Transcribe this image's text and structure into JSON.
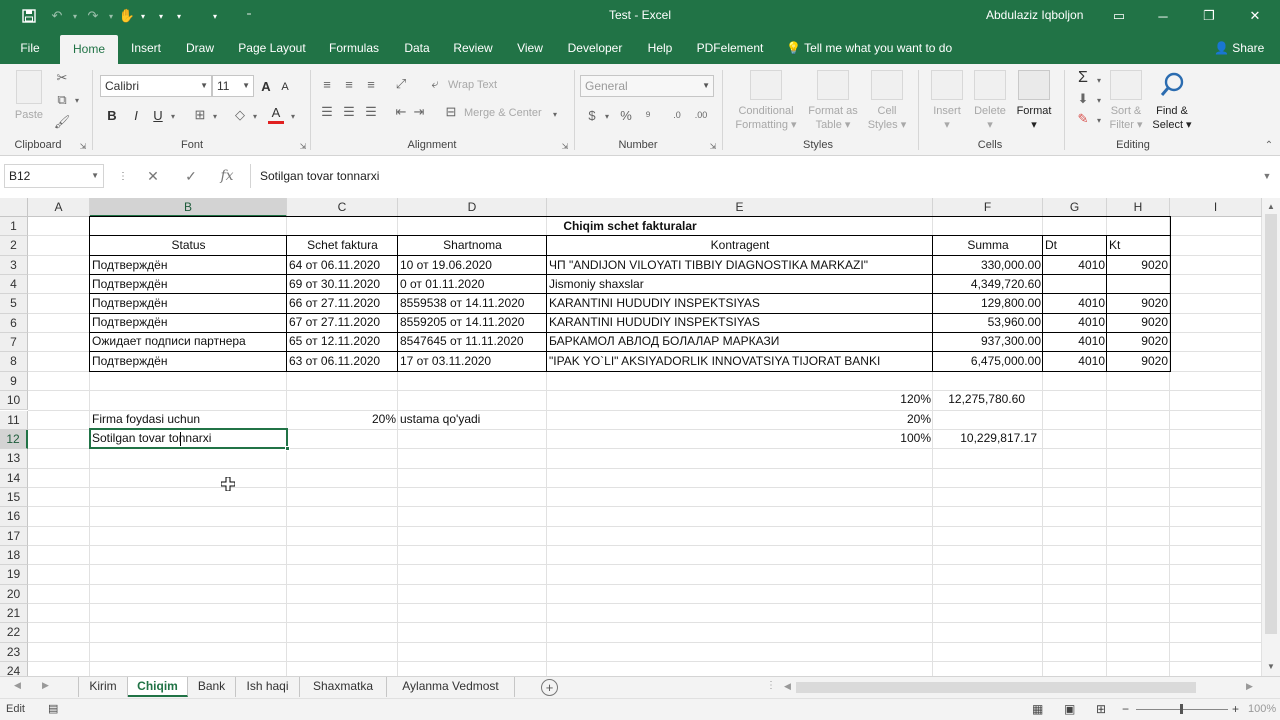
{
  "titlebar": {
    "title": "Test  -  Excel",
    "user": "Abdulaziz Iqboljon"
  },
  "tabs": [
    {
      "label": "File"
    },
    {
      "label": "Home"
    },
    {
      "label": "Insert"
    },
    {
      "label": "Draw"
    },
    {
      "label": "Page Layout"
    },
    {
      "label": "Formulas"
    },
    {
      "label": "Data"
    },
    {
      "label": "Review"
    },
    {
      "label": "View"
    },
    {
      "label": "Developer"
    },
    {
      "label": "Help"
    },
    {
      "label": "PDFelement"
    }
  ],
  "tell_me": "Tell me what you want to do",
  "share": "Share",
  "ribbon": {
    "clipboard": {
      "paste": "Paste",
      "label": "Clipboard"
    },
    "font": {
      "name": "Calibri",
      "size": "11",
      "label": "Font"
    },
    "alignment": {
      "wrap": "Wrap Text",
      "merge": "Merge & Center",
      "label": "Alignment"
    },
    "number": {
      "format": "General",
      "label": "Number"
    },
    "styles": {
      "conditional_1": "Conditional",
      "conditional_2": "Formatting",
      "format_table_1": "Format as",
      "format_table_2": "Table",
      "cell_styles_1": "Cell",
      "cell_styles_2": "Styles",
      "label": "Styles"
    },
    "cells": {
      "insert": "Insert",
      "delete": "Delete",
      "format": "Format",
      "label": "Cells"
    },
    "editing": {
      "sort_1": "Sort &",
      "sort_2": "Filter",
      "find_1": "Find &",
      "find_2": "Select",
      "label": "Editing"
    }
  },
  "formula_bar": {
    "name_box": "B12",
    "formula": "Sotilgan tovar tonnarxi"
  },
  "columns": [
    "A",
    "B",
    "C",
    "D",
    "E",
    "F",
    "G",
    "H",
    "I"
  ],
  "rows": [
    "1",
    "2",
    "3",
    "4",
    "5",
    "6",
    "7",
    "8",
    "9",
    "10",
    "11",
    "12",
    "13",
    "14",
    "15",
    "16",
    "17",
    "18",
    "19",
    "20",
    "21",
    "22",
    "23",
    "24"
  ],
  "table": {
    "title": "Chiqim schet fakturalar",
    "headers": [
      "Status",
      "Schet faktura",
      "Shartnoma",
      "Kontragent",
      "Summa",
      "Dt",
      "Kt"
    ],
    "rows": [
      [
        "Подтверждён",
        "64 от 06.11.2020",
        "10 от 19.06.2020",
        "ЧП \"ANDIJON VILOYATI TIBBIY DIAGNOSTIKA MARKAZI\"",
        "330,000.00",
        "4010",
        "9020"
      ],
      [
        "Подтверждён",
        "69 от 30.11.2020",
        "0 от 01.11.2020",
        "Jismoniy shaxslar",
        "4,349,720.60",
        "",
        ""
      ],
      [
        "Подтверждён",
        "66 от 27.11.2020",
        "8559538 от 14.11.2020",
        "KARANTINI HUDUDIY INSPEKTSIYAS",
        "129,800.00",
        "4010",
        "9020"
      ],
      [
        "Подтверждён",
        "67 от 27.11.2020",
        "8559205 от 14.11.2020",
        "KARANTINI HUDUDIY INSPEKTSIYAS",
        "53,960.00",
        "4010",
        "9020"
      ],
      [
        "Ожидает подписи партнера",
        "65 от 12.11.2020",
        "8547645 от 11.11.2020",
        "БАРКАМОЛ АВЛОД БОЛАЛАР МАРКАЗИ",
        "937,300.00",
        "4010",
        "9020"
      ],
      [
        "Подтверждён",
        "63 от 06.11.2020",
        "17 от 03.11.2020",
        "\"IPAK YO`LI\" AKSIYADORLIK INNOVATSIYA TIJORAT BANKI",
        "6,475,000.00",
        "4010",
        "9020"
      ]
    ]
  },
  "extra": {
    "e10_pct": "120%",
    "f10": "12,275,780.60",
    "b11": "Firma foydasi uchun",
    "c11": "20%",
    "d11": "ustama qo'yadi",
    "e11_pct": "20%",
    "b12": "Sotilgan tovar tonnarxi",
    "e12_pct": "100%",
    "f12": "10,229,817.17"
  },
  "sheets": [
    "Kirim",
    "Chiqim",
    "Bank",
    "Ish haqi",
    "Shaxmatka",
    "Aylanma Vedmost"
  ],
  "active_sheet": "Chiqim",
  "status": {
    "mode": "Edit",
    "zoom": "100%"
  },
  "colors": {
    "brand": "#217346"
  }
}
